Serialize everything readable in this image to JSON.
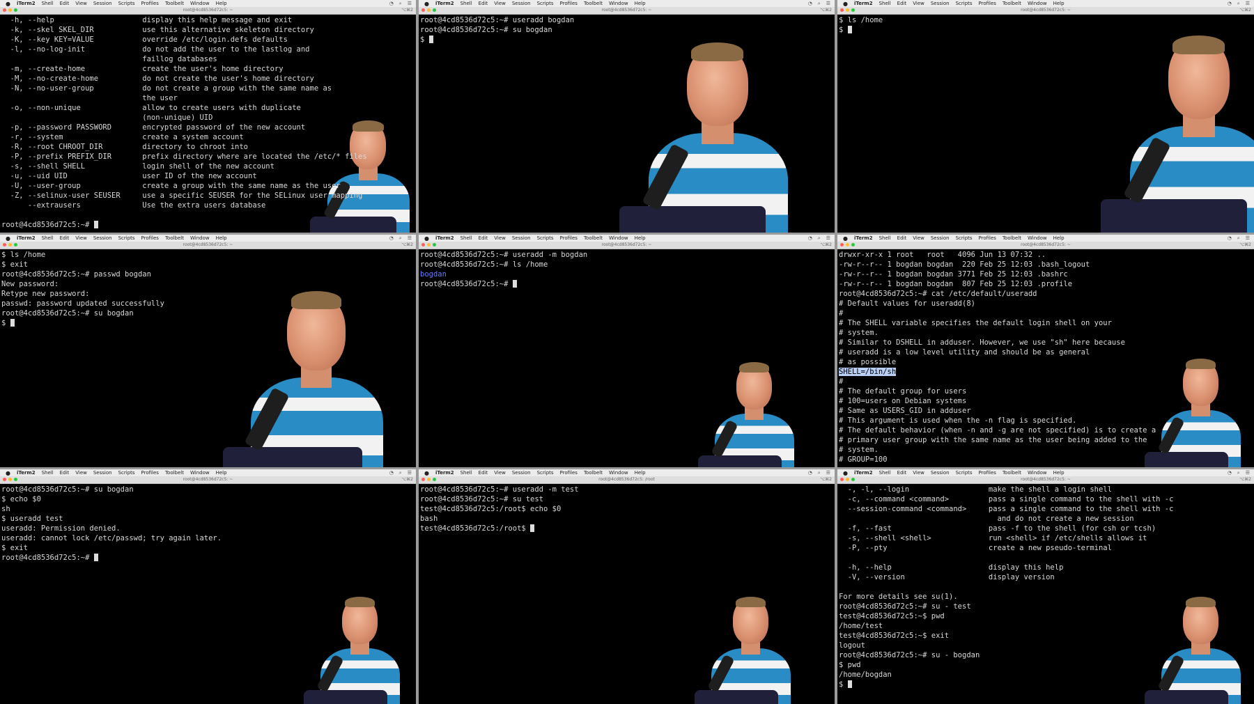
{
  "menubar": {
    "app": "iTerm2",
    "items": [
      "Shell",
      "Edit",
      "View",
      "Session",
      "Scripts",
      "Profiles",
      "Toolbelt",
      "Window",
      "Help"
    ]
  },
  "window_title": "root@4cd8536d72c5: ~",
  "window_title_alt": "root@4cd8536d72c5: /root",
  "shortcut": "⌥⌘2",
  "colors": {
    "menubar": "#ececec",
    "terminal_bg": "#000000",
    "text": "#d8d8d8",
    "dir": "#6a78ff",
    "highlight": "#b9cff5",
    "shirt_blue": "#2a8cc4"
  },
  "panels": [
    {
      "id": "p1",
      "title": "root@4cd8536d72c5: ~",
      "lines": [
        "  -h, --help                    display this help message and exit",
        "  -k, --skel SKEL_DIR           use this alternative skeleton directory",
        "  -K, --key KEY=VALUE           override /etc/login.defs defaults",
        "  -l, --no-log-init             do not add the user to the lastlog and",
        "                                faillog databases",
        "  -m, --create-home             create the user's home directory",
        "  -M, --no-create-home          do not create the user's home directory",
        "  -N, --no-user-group           do not create a group with the same name as",
        "                                the user",
        "  -o, --non-unique              allow to create users with duplicate",
        "                                (non-unique) UID",
        "  -p, --password PASSWORD       encrypted password of the new account",
        "  -r, --system                  create a system account",
        "  -R, --root CHROOT_DIR         directory to chroot into",
        "  -P, --prefix PREFIX_DIR       prefix directory where are located the /etc/* files",
        "  -s, --shell SHELL             login shell of the new account",
        "  -u, --uid UID                 user ID of the new account",
        "  -U, --user-group              create a group with the same name as the user",
        "  -Z, --selinux-user SEUSER     use a specific SEUSER for the SELinux user mapping",
        "      --extrausers              Use the extra users database",
        "",
        "root@4cd8536d72c5:~# "
      ]
    },
    {
      "id": "p2",
      "title": "root@4cd8536d72c5: ~",
      "lines": [
        "root@4cd8536d72c5:~# useradd bogdan",
        "root@4cd8536d72c5:~# su bogdan",
        "$ "
      ]
    },
    {
      "id": "p3",
      "title": "root@4cd8536d72c5: ~",
      "lines": [
        "$ ls /home",
        "$ "
      ]
    },
    {
      "id": "p4",
      "title": "root@4cd8536d72c5: ~",
      "lines": [
        "$ ls /home",
        "$ exit",
        "root@4cd8536d72c5:~# passwd bogdan",
        "New password:",
        "Retype new password:",
        "passwd: password updated successfully",
        "root@4cd8536d72c5:~# su bogdan",
        "$ "
      ]
    },
    {
      "id": "p5",
      "title": "root@4cd8536d72c5: ~",
      "lines": [
        "root@4cd8536d72c5:~# useradd -m bogdan",
        "root@4cd8536d72c5:~# ls /home",
        "bogdan",
        "root@4cd8536d72c5:~# "
      ]
    },
    {
      "id": "p6",
      "title": "root@4cd8536d72c5: ~",
      "lines": [
        "drwxr-xr-x 1 root   root   4096 Jun 13 07:32 ..",
        "-rw-r--r-- 1 bogdan bogdan  220 Feb 25 12:03 .bash_logout",
        "-rw-r--r-- 1 bogdan bogdan 3771 Feb 25 12:03 .bashrc",
        "-rw-r--r-- 1 bogdan bogdan  807 Feb 25 12:03 .profile",
        "root@4cd8536d72c5:~# cat /etc/default/useradd",
        "# Default values for useradd(8)",
        "#",
        "# The SHELL variable specifies the default login shell on your",
        "# system.",
        "# Similar to DSHELL in adduser. However, we use \"sh\" here because",
        "# useradd is a low level utility and should be as general",
        "# as possible",
        "SHELL=/bin/sh",
        "#",
        "# The default group for users",
        "# 100=users on Debian systems",
        "# Same as USERS_GID in adduser",
        "# This argument is used when the -n flag is specified.",
        "# The default behavior (when -n and -g are not specified) is to create a",
        "# primary user group with the same name as the user being added to the",
        "# system.",
        "# GROUP=100"
      ]
    },
    {
      "id": "p7",
      "title": "root@4cd8536d72c5: ~",
      "lines": [
        "root@4cd8536d72c5:~# su bogdan",
        "$ echo $0",
        "sh",
        "$ useradd test",
        "useradd: Permission denied.",
        "useradd: cannot lock /etc/passwd; try again later.",
        "$ exit",
        "root@4cd8536d72c5:~# "
      ]
    },
    {
      "id": "p8",
      "title": "root@4cd8536d72c5: /root",
      "lines": [
        "root@4cd8536d72c5:~# useradd -m test",
        "root@4cd8536d72c5:~# su test",
        "test@4cd8536d72c5:/root$ echo $0",
        "bash",
        "test@4cd8536d72c5:/root$ "
      ]
    },
    {
      "id": "p9",
      "title": "root@4cd8536d72c5: ~",
      "lines": [
        "  -, -l, --login                  make the shell a login shell",
        "  -c, --command <command>         pass a single command to the shell with -c",
        "  --session-command <command>     pass a single command to the shell with -c",
        "                                    and do not create a new session",
        "  -f, --fast                      pass -f to the shell (for csh or tcsh)",
        "  -s, --shell <shell>             run <shell> if /etc/shells allows it",
        "  -P, --pty                       create a new pseudo-terminal",
        "",
        "  -h, --help                      display this help",
        "  -V, --version                   display version",
        "",
        "For more details see su(1).",
        "root@4cd8536d72c5:~# su - test",
        "test@4cd8536d72c5:~$ pwd",
        "/home/test",
        "test@4cd8536d72c5:~$ exit",
        "logout",
        "root@4cd8536d72c5:~# su - bogdan",
        "$ pwd",
        "/home/bogdan",
        "$ "
      ]
    }
  ]
}
